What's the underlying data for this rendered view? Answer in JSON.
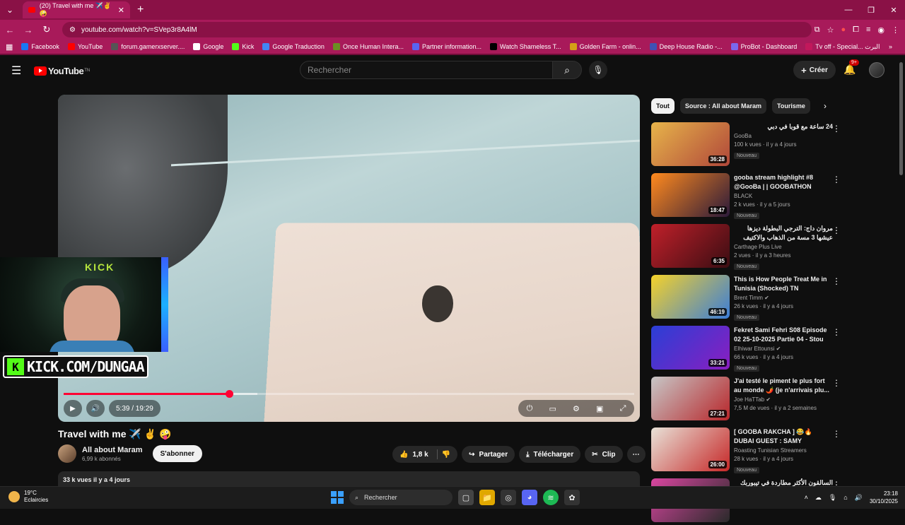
{
  "browser": {
    "tab_title": "(20) Travel with me ✈️✌️🤪",
    "url": "youtube.com/watch?v=SVep3r8A4lM",
    "bookmarks": [
      {
        "label": "Facebook",
        "color": "#1877f2"
      },
      {
        "label": "YouTube",
        "color": "#ff0000"
      },
      {
        "label": "forum.gamerxserver....",
        "color": "#555555"
      },
      {
        "label": "Google",
        "color": "#ffffff"
      },
      {
        "label": "Kick",
        "color": "#53fc18"
      },
      {
        "label": "Google Traduction",
        "color": "#4285f4"
      },
      {
        "label": "Once Human Intera...",
        "color": "#6b8e23"
      },
      {
        "label": "Partner information...",
        "color": "#5865f2"
      },
      {
        "label": "Watch Shameless T...",
        "color": "#000000"
      },
      {
        "label": "Golden Farm - onlin...",
        "color": "#d4a017"
      },
      {
        "label": "Deep House Radio -...",
        "color": "#3f51b5"
      },
      {
        "label": "ProBot - Dashboard",
        "color": "#7b68ee"
      },
      {
        "label": "Tv off - Special... البرت",
        "color": "#c2185b"
      }
    ]
  },
  "header": {
    "logo_text": "YouTube",
    "logo_sup": "TN",
    "search_placeholder": "Rechercher",
    "create_label": "Créer",
    "notif_count": "9+"
  },
  "player": {
    "time": "5:39 / 19:29",
    "progress_played": 0.29,
    "progress_buffered": 0.34,
    "stream_banner": "KICK.COM/DUNGAA"
  },
  "video": {
    "title": "Travel with me ✈️ ✌️ 🤪",
    "channel": "All about Maram",
    "subscribers": "6,99 k abonnés",
    "subscribe_label": "S'abonner",
    "likes": "1,8 k",
    "share_label": "Partager",
    "download_label": "Télécharger",
    "clip_label": "Clip",
    "stats": "33 k vues  il y a 4 jours"
  },
  "chips": [
    "Tout",
    "Source : All about Maram",
    "Tourisme"
  ],
  "recommendations": [
    {
      "title": "24 ساعة مع قوبا في دبي",
      "channel": "GooBa",
      "views": "100 k vues · il y a 4 jours",
      "badge": "Nouveau",
      "duration": "36:28",
      "thumb_a": "#e7b44a",
      "thumb_b": "#b0473a"
    },
    {
      "title": "gooba stream highlight #8 @GooBa | | GOOBATHON",
      "channel": "BLACK",
      "views": "2 k vues · il y a 5 jours",
      "badge": "Nouveau",
      "duration": "18:47",
      "thumb_a": "#ff8a1e",
      "thumb_b": "#2b1a3a"
    },
    {
      "title": "مروان داج: الترجي البطولة ديزها عيشها 3 مسة من الذهاب والاكتيف متاعها يعمل",
      "channel": "Carthage Plus Live",
      "views": "2 vues · il y a 3 heures",
      "badge": "Nouveau",
      "duration": "6:35",
      "thumb_a": "#c0202a",
      "thumb_b": "#3a0d12"
    },
    {
      "title": "This is How People Treat Me in Tunisia (Shocked) TN",
      "channel": "Brent Timm ✔",
      "views": "26 k vues · il y a 4 jours",
      "badge": "Nouveau",
      "duration": "46:19",
      "thumb_a": "#f5d22a",
      "thumb_b": "#3b7dd8"
    },
    {
      "title": "Fekret Sami Fehri S08 Episode 02 25-10-2025 Partie 04 - Stou",
      "channel": "Elhiwar Ettounsi ✔",
      "views": "66 k vues · il y a 4 jours",
      "badge": "Nouveau",
      "duration": "33:21",
      "thumb_a": "#2a3fd6",
      "thumb_b": "#8a1ec0"
    },
    {
      "title": "J'ai testé le piment le plus fort au monde 🌶️ (je n'arrivais plu...",
      "channel": "Joe HaTTab ✔",
      "views": "7,5 M de vues · il y a 2 semaines",
      "badge": "",
      "duration": "27:21",
      "thumb_a": "#c7c7c7",
      "thumb_b": "#b8262a"
    },
    {
      "title": "[ GOOBA RAKCHA ] 😂🔥 DUBAI GUEST : SAMY CHAFFA...",
      "channel": "Roasting Tunisian Streamers",
      "views": "28 k vues · il y a 4 jours",
      "badge": "Nouveau",
      "duration": "26:00",
      "thumb_a": "#e8e2d8",
      "thumb_b": "#c62828"
    },
    {
      "title": "السالقون الأكثر مطاردة في تيبوربك",
      "channel": "",
      "views": "",
      "badge": "",
      "duration": "",
      "thumb_a": "#d946a0",
      "thumb_b": "#2a2a2a"
    }
  ],
  "taskbar": {
    "temp": "19°C",
    "weather": "Eclaircies",
    "search": "Rechercher",
    "time": "23:18",
    "date": "30/10/2025"
  }
}
